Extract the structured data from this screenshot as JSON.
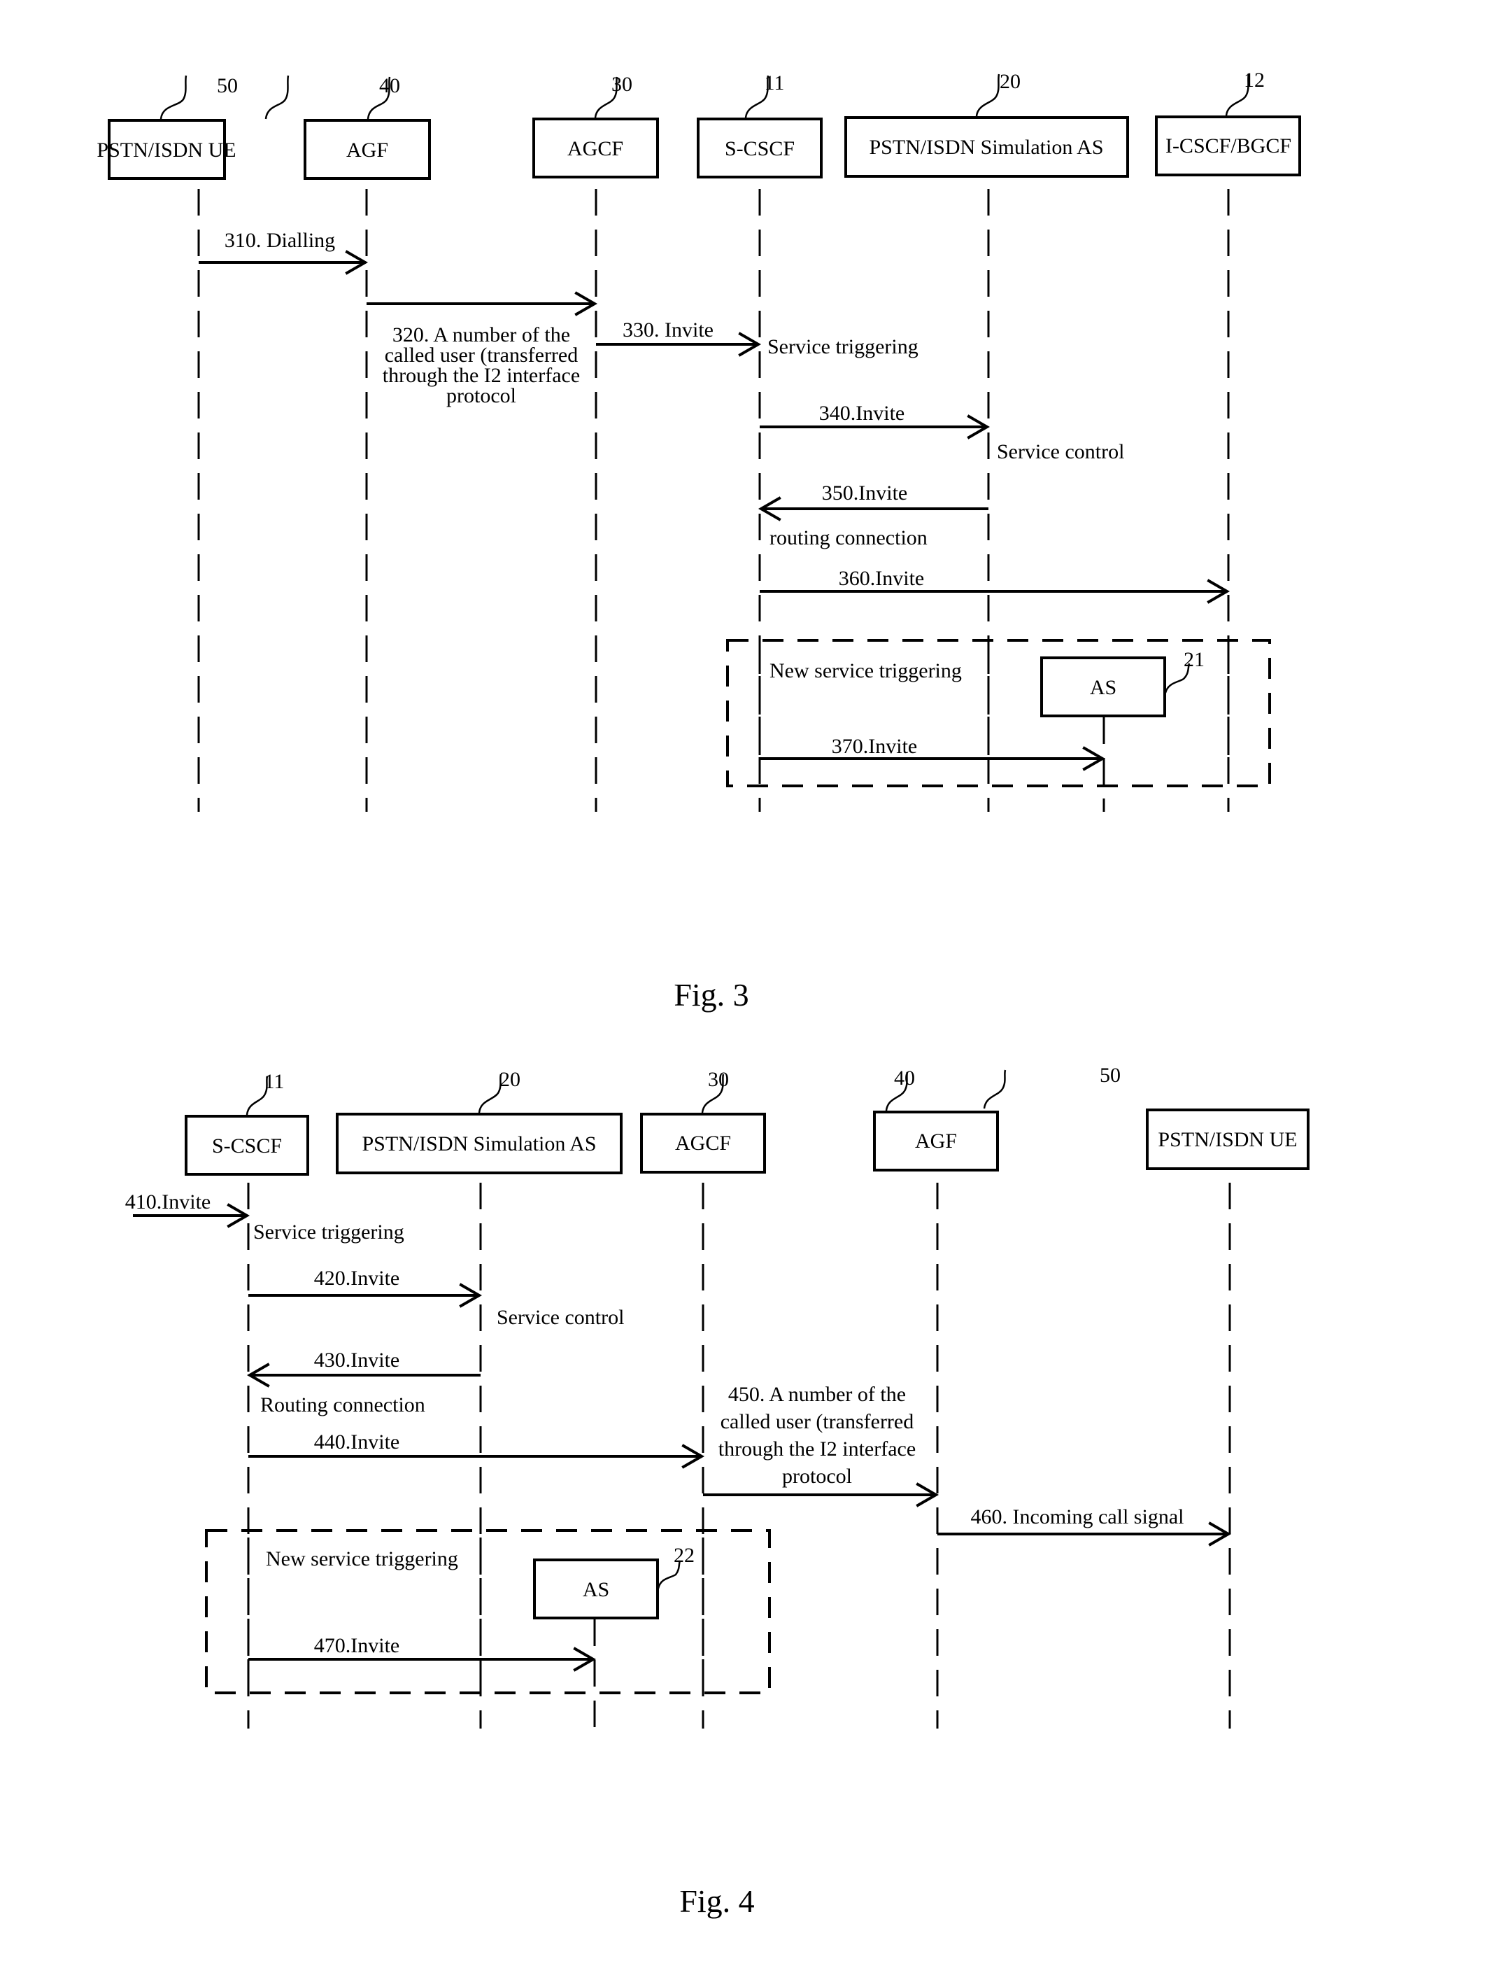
{
  "fig3": {
    "caption": "Fig. 3",
    "participants": [
      {
        "id": "ue",
        "label": "PSTN/ISDN UE",
        "ref": "50"
      },
      {
        "id": "agf",
        "label": "AGF",
        "ref": "40"
      },
      {
        "id": "agcf",
        "label": "AGCF",
        "ref": "30"
      },
      {
        "id": "scscf",
        "label": "S-CSCF",
        "ref": "11"
      },
      {
        "id": "simas",
        "label": "PSTN/ISDN Simulation AS",
        "ref": "20"
      },
      {
        "id": "icscf",
        "label": "I-CSCF/BGCF",
        "ref": "12"
      }
    ],
    "messages": [
      {
        "from": "ue",
        "to": "agf",
        "label": "310. Dialling"
      },
      {
        "from": "agf",
        "to": "agcf",
        "label": "320. A number of the called user (transferred through the I2 interface protocol",
        "label_lines": [
          "320. A number of the",
          "called user (transferred",
          "through the I2 interface",
          "protocol"
        ]
      },
      {
        "from": "agcf",
        "to": "scscf",
        "label": "330. Invite"
      },
      {
        "from": "scscf",
        "to": "simas",
        "label": "340.Invite"
      },
      {
        "from": "simas",
        "to": "scscf",
        "label": "350.Invite"
      },
      {
        "from": "scscf",
        "to": "icscf",
        "label": "360.Invite"
      },
      {
        "from": "scscf",
        "to": "as21",
        "label": "370.Invite"
      }
    ],
    "notes": [
      {
        "at": "scscf",
        "text": "Service triggering"
      },
      {
        "at": "simas",
        "text": "Service control"
      },
      {
        "at": "scscf",
        "text": "routing connection"
      }
    ],
    "group": {
      "note": "New service triggering",
      "as_box": {
        "id": "as21",
        "label": "AS",
        "ref": "21"
      }
    }
  },
  "fig4": {
    "caption": "Fig. 4",
    "participants": [
      {
        "id": "scscf",
        "label": "S-CSCF",
        "ref": "11"
      },
      {
        "id": "simas",
        "label": "PSTN/ISDN Simulation AS",
        "ref": "20"
      },
      {
        "id": "agcf",
        "label": "AGCF",
        "ref": "30"
      },
      {
        "id": "agf",
        "label": "AGF",
        "ref": "40"
      },
      {
        "id": "ue",
        "label": "PSTN/ISDN UE",
        "ref": "50"
      }
    ],
    "messages": [
      {
        "from": "external",
        "to": "scscf",
        "label": "410.Invite"
      },
      {
        "from": "scscf",
        "to": "simas",
        "label": "420.Invite"
      },
      {
        "from": "simas",
        "to": "scscf",
        "label": "430.Invite"
      },
      {
        "from": "scscf",
        "to": "agcf",
        "label": "440.Invite"
      },
      {
        "from": "agcf",
        "to": "agf",
        "label": "450. A number of the called user (transferred through the I2 interface protocol",
        "label_lines": [
          "450. A number of the",
          "called user (transferred",
          "through the I2 interface",
          "protocol"
        ]
      },
      {
        "from": "agf",
        "to": "ue",
        "label": "460. Incoming call signal"
      },
      {
        "from": "scscf",
        "to": "as22",
        "label": "470.Invite"
      }
    ],
    "notes": [
      {
        "at": "scscf",
        "text": "Service triggering"
      },
      {
        "at": "simas",
        "text": "Service control"
      },
      {
        "at": "scscf",
        "text": "Routing  connection"
      }
    ],
    "group": {
      "note": "New service triggering",
      "as_box": {
        "id": "as22",
        "label": "AS",
        "ref": "22"
      }
    }
  }
}
